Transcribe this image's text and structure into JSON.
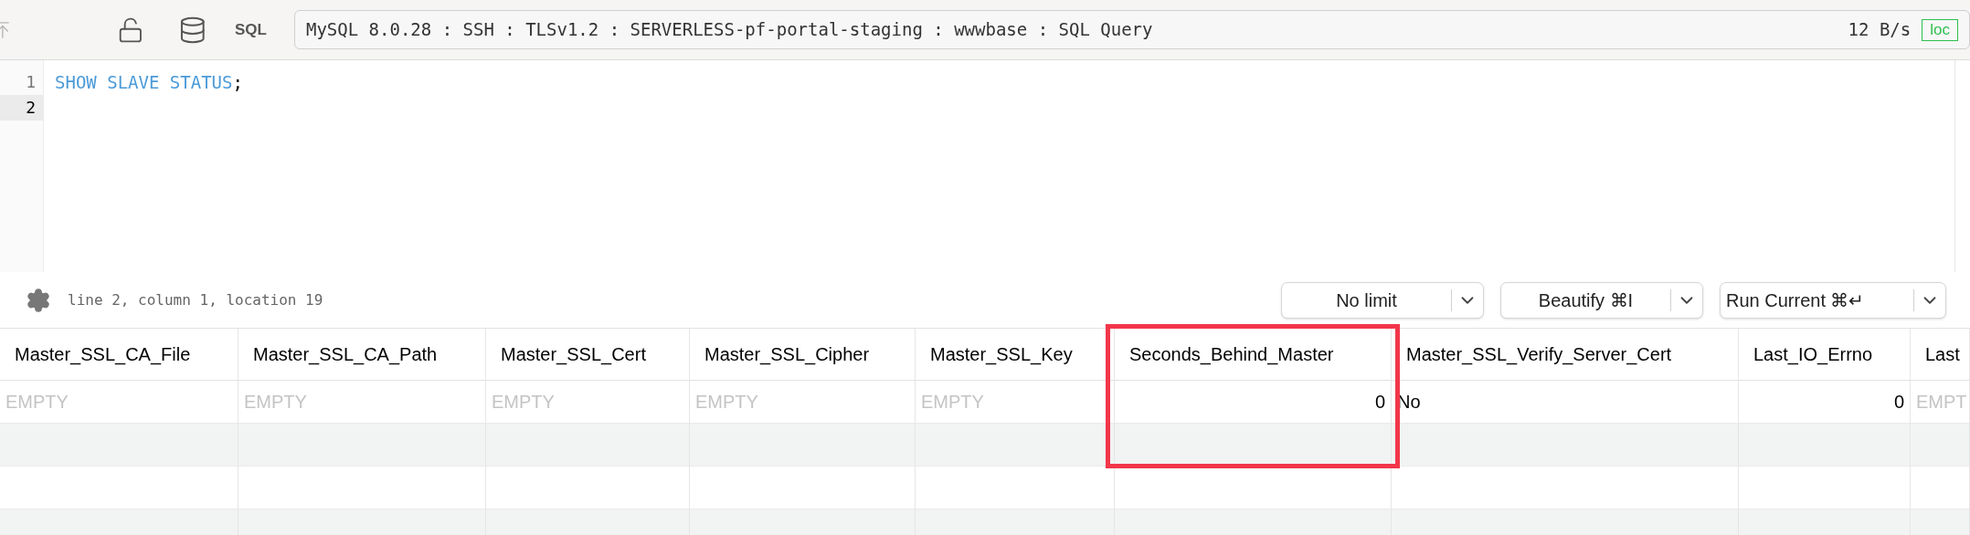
{
  "toolbar": {
    "sql_label": "SQL",
    "connection": "MySQL 8.0.28 : SSH : TLSv1.2 : SERVERLESS-pf-portal-staging : wwwbase : SQL Query",
    "speed": "12 B/s",
    "badge": "loc"
  },
  "editor": {
    "lines": [
      {
        "number": "1",
        "code": "SHOW SLAVE STATUS",
        "suffix": ";",
        "selected": false
      },
      {
        "number": "2",
        "selected": true
      }
    ]
  },
  "status": {
    "position": "line 2, column 1, location 19"
  },
  "buttons": [
    {
      "label": "No limit"
    },
    {
      "label": "Beautify ⌘I"
    },
    {
      "label": "Run Current ⌘↵"
    }
  ],
  "table": {
    "columns": [
      {
        "name": "Master_SSL_CA_File",
        "highlighted": false
      },
      {
        "name": "Master_SSL_CA_Path",
        "highlighted": false
      },
      {
        "name": "Master_SSL_Cert",
        "highlighted": false
      },
      {
        "name": "Master_SSL_Cipher",
        "highlighted": false
      },
      {
        "name": "Master_SSL_Key",
        "highlighted": false
      },
      {
        "name": "Seconds_Behind_Master",
        "highlighted": true
      },
      {
        "name": "Master_SSL_Verify_Server_Cert",
        "highlighted": false
      },
      {
        "name": "Last_IO_Errno",
        "highlighted": false
      },
      {
        "name": "Last",
        "highlighted": false
      }
    ],
    "rows": [
      {
        "cells": [
          {
            "kind": "empty",
            "text": "EMPTY"
          },
          {
            "kind": "empty",
            "text": "EMPTY"
          },
          {
            "kind": "empty",
            "text": "EMPTY"
          },
          {
            "kind": "empty",
            "text": "EMPTY"
          },
          {
            "kind": "empty",
            "text": "EMPTY"
          },
          {
            "kind": "number",
            "text": "0"
          },
          {
            "kind": "text",
            "text": "No"
          },
          {
            "kind": "number",
            "text": "0"
          },
          {
            "kind": "empty",
            "text": "EMPT"
          }
        ]
      }
    ]
  }
}
